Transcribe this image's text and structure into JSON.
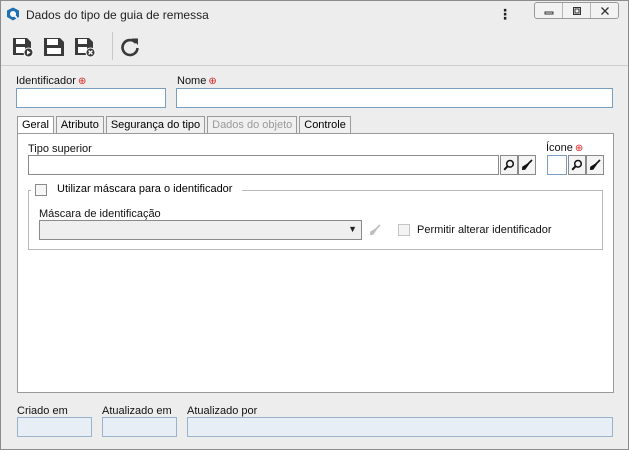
{
  "window": {
    "title": "Dados do tipo de guia de remessa",
    "menu_icon": "kebab-menu-icon",
    "controls": [
      "minimize-icon",
      "maximize-icon",
      "close-icon"
    ]
  },
  "toolbar": {
    "buttons": [
      "save-and-new-icon",
      "save-icon",
      "save-and-close-icon",
      "refresh-icon"
    ]
  },
  "form": {
    "identificador_label": "Identificador",
    "identificador_value": "",
    "nome_label": "Nome",
    "nome_value": "",
    "required_mark": "⊕"
  },
  "tabs": [
    {
      "label": "Geral",
      "state": "active"
    },
    {
      "label": "Atributo",
      "state": "enabled"
    },
    {
      "label": "Segurança do tipo",
      "state": "enabled"
    },
    {
      "label": "Dados do objeto",
      "state": "disabled"
    },
    {
      "label": "Controle",
      "state": "enabled"
    }
  ],
  "geral": {
    "tipo_superior_label": "Tipo superior",
    "tipo_superior_value": "",
    "icone_label": "Ícone",
    "mascara_checkbox_label": "Utilizar máscara para o identificador",
    "mascara_label": "Máscara de identificação",
    "mascara_value": "",
    "permitir_label": "Permitir alterar identificador"
  },
  "footer": {
    "criado_em_label": "Criado em",
    "atualizado_em_label": "Atualizado em",
    "atualizado_por_label": "Atualizado por",
    "criado_em_value": "",
    "atualizado_em_value": "",
    "atualizado_por_value": ""
  },
  "colors": {
    "input_border": "#7a9ec2",
    "required": "#dd2222",
    "readonly_bg": "#e7eef5",
    "app_icon": "#1f6fb3"
  }
}
